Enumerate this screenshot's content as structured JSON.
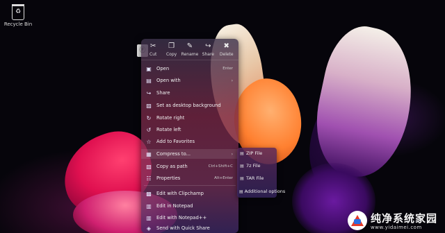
{
  "desktop": {
    "recycle_bin_label": "Recycle Bin",
    "file_icon_glyph": "Ⓕ"
  },
  "context_menu": {
    "quick_actions": [
      {
        "icon": "cut-icon",
        "glyph": "✂",
        "label": "Cut"
      },
      {
        "icon": "copy-icon",
        "glyph": "❐",
        "label": "Copy"
      },
      {
        "icon": "rename-icon",
        "glyph": "✎",
        "label": "Rename"
      },
      {
        "icon": "share-icon",
        "glyph": "↪",
        "label": "Share"
      },
      {
        "icon": "delete-icon",
        "glyph": "✖",
        "label": "Delete"
      }
    ],
    "items": [
      {
        "icon": "open-icon",
        "glyph": "▣",
        "label": "Open",
        "shortcut": "Enter"
      },
      {
        "icon": "open-with-icon",
        "glyph": "▤",
        "label": "Open with",
        "submenu": true
      },
      {
        "icon": "share-icon",
        "glyph": "↪",
        "label": "Share"
      },
      {
        "icon": "wallpaper-icon",
        "glyph": "▨",
        "label": "Set as desktop background"
      },
      {
        "icon": "rotate-right-icon",
        "glyph": "↻",
        "label": "Rotate right"
      },
      {
        "icon": "rotate-left-icon",
        "glyph": "↺",
        "label": "Rotate left"
      },
      {
        "icon": "star-icon",
        "glyph": "☆",
        "label": "Add to Favorites"
      },
      {
        "icon": "compress-icon",
        "glyph": "▦",
        "label": "Compress to...",
        "submenu": true
      },
      {
        "icon": "copy-path-icon",
        "glyph": "▧",
        "label": "Copy as path",
        "shortcut": "Ctrl+Shift+C"
      },
      {
        "icon": "properties-icon",
        "glyph": "☷",
        "label": "Properties",
        "shortcut": "Alt+Enter"
      },
      {
        "icon": "clipchamp-icon",
        "glyph": "▩",
        "label": "Edit with Clipchamp"
      },
      {
        "icon": "notepad-icon",
        "glyph": "▥",
        "label": "Edit in Notepad"
      },
      {
        "icon": "notepadpp-icon",
        "glyph": "▥",
        "label": "Edit with Notepad++"
      },
      {
        "icon": "quick-share-icon",
        "glyph": "◈",
        "label": "Send with Quick Share"
      }
    ],
    "submenu_items": [
      {
        "icon": "zip-icon",
        "glyph": "▤",
        "label": "ZIP File"
      },
      {
        "icon": "7z-icon",
        "glyph": "▤",
        "label": "7z File"
      },
      {
        "icon": "tar-icon",
        "glyph": "▤",
        "label": "TAR File"
      },
      {
        "icon": "options-icon",
        "glyph": "▤",
        "label": "Additional options"
      }
    ]
  },
  "watermark": {
    "title": "纯净系统家园",
    "url": "www.yidaimei.com"
  }
}
